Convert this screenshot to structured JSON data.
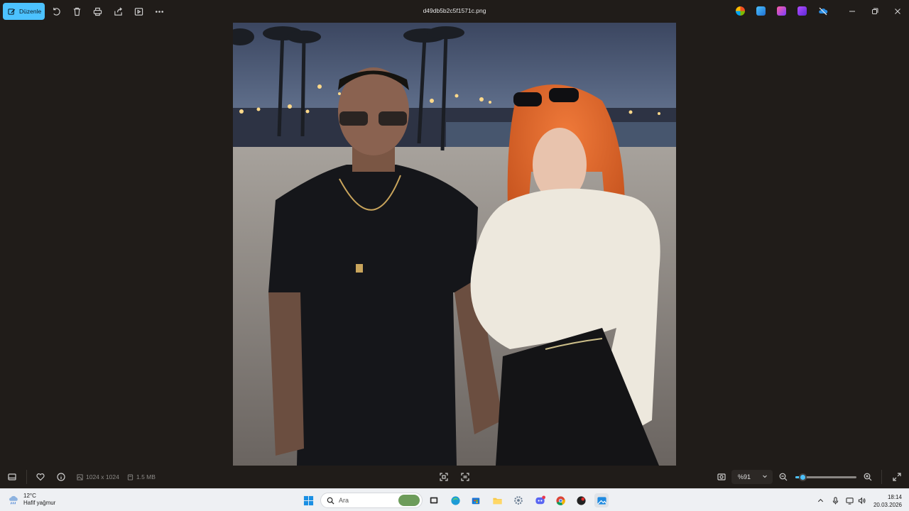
{
  "window": {
    "title": "d49db5b2c5f1571c.png",
    "edit_label": "Düzenle"
  },
  "toolbar": {
    "icons": [
      "rotate-icon",
      "delete-icon",
      "print-icon",
      "share-icon",
      "slideshow-icon",
      "more-icon"
    ]
  },
  "bottombar": {
    "dimensions": "1024 x 1024",
    "file_size": "1.5 MB",
    "zoom_value": "%91",
    "zoom_fraction": 0.12
  },
  "taskbar": {
    "weather_temp": "12°C",
    "weather_desc": "Hafif yağmur",
    "search_placeholder": "Ara",
    "time": "18:14",
    "date": "20.03.2026"
  },
  "colors": {
    "accent": "#4cc2ff",
    "background": "#201c19",
    "taskbar": "#eef0f3"
  }
}
